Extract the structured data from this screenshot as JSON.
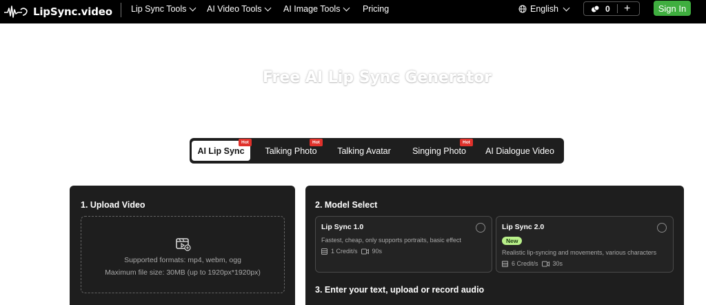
{
  "brand": {
    "name": "LipSync.video"
  },
  "nav": {
    "items": [
      {
        "label": "Lip Sync Tools",
        "dropdown": true
      },
      {
        "label": "AI Video Tools",
        "dropdown": true
      },
      {
        "label": "AI Image Tools",
        "dropdown": true
      },
      {
        "label": "Pricing",
        "dropdown": false
      }
    ],
    "language": "English",
    "credits": "0",
    "add_label": "+",
    "signin": "Sign In"
  },
  "hero": {
    "title": "Free AI Lip Sync Generator"
  },
  "tabs": [
    {
      "label": "AI Lip Sync",
      "hot": true,
      "active": true
    },
    {
      "label": "Talking Photo",
      "hot": true,
      "active": false
    },
    {
      "label": "Talking Avatar",
      "hot": false,
      "active": false
    },
    {
      "label": "Singing Photo",
      "hot": true,
      "active": false
    },
    {
      "label": "AI Dialogue Video",
      "hot": false,
      "active": false
    }
  ],
  "hot_label": "Hot",
  "upload": {
    "title": "1. Upload Video",
    "formats": "Supported formats: mp4, webm, ogg",
    "max_size": "Maximum file size: 30MB (up to 1920px*1920px)"
  },
  "model": {
    "title": "2. Model Select",
    "options": [
      {
        "name": "Lip Sync 1.0",
        "badge": "",
        "desc": "Fastest, cheap, only supports portraits, basic effect",
        "credits": "1 Credit/s",
        "duration": "90s"
      },
      {
        "name": "Lip Sync 2.0",
        "badge": "New",
        "desc": "Realistic lip-syncing and movements, various characters",
        "credits": "6 Credit/s",
        "duration": "30s"
      }
    ]
  },
  "audio": {
    "title": "3. Enter your text, upload or record audio"
  },
  "colors": {
    "accent_green": "#3fae3f",
    "hot_red": "#e0312b",
    "new_green": "#b9f08a",
    "panel": "#1e1e1e"
  }
}
